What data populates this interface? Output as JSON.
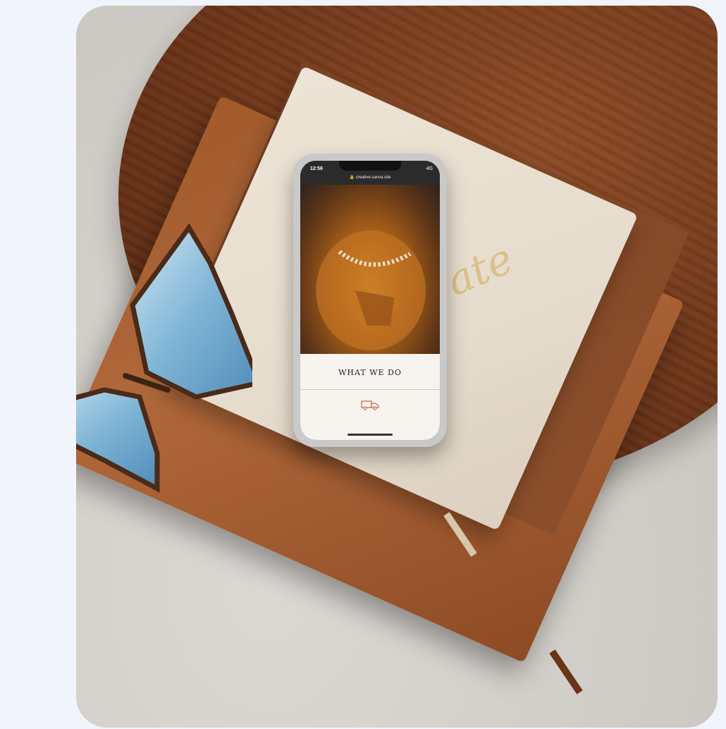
{
  "phone": {
    "time": "12:56",
    "signal": "4G",
    "url": "creative.canva.site",
    "section_title": "WHAT WE DO"
  },
  "book": {
    "cover_script": "ate"
  },
  "icons": [
    "lock-icon",
    "truck-icon",
    "butterfly"
  ]
}
